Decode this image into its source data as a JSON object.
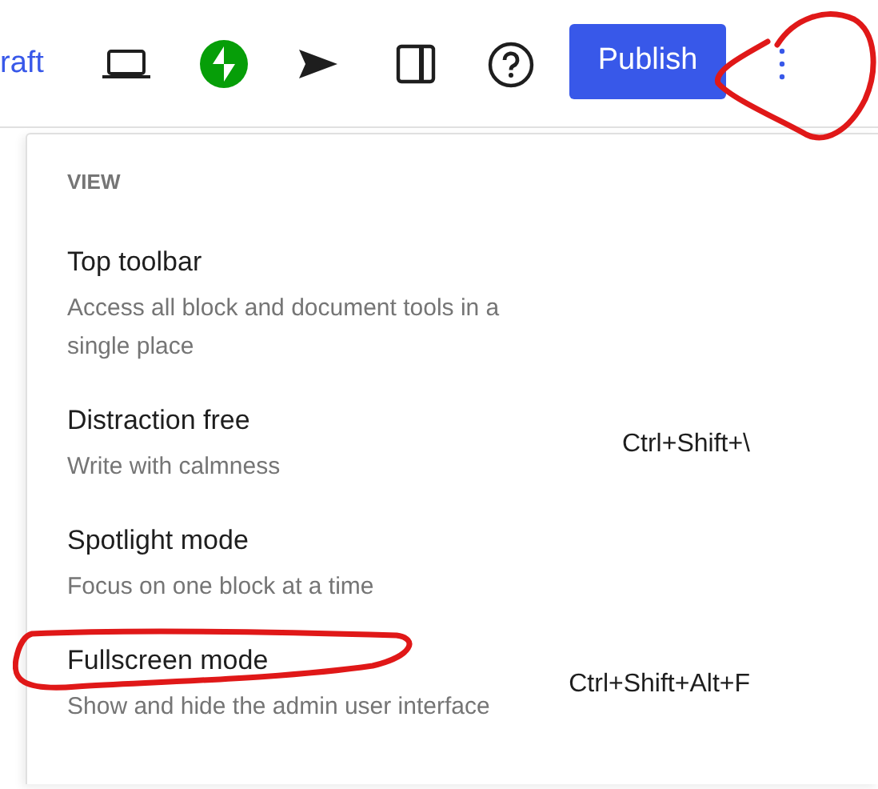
{
  "toolbar": {
    "draft_link": "raft",
    "publish_button": "Publish"
  },
  "menu": {
    "section_label": "VIEW",
    "items": [
      {
        "title": "Top toolbar",
        "description": "Access all block and document tools in a single place"
      },
      {
        "title": "Distraction free",
        "description": "Write with calmness",
        "shortcut": "Ctrl+Shift+\\"
      },
      {
        "title": "Spotlight mode",
        "description": "Focus on one block at a time"
      },
      {
        "title": "Fullscreen mode",
        "description": "Show and hide the admin user interface",
        "shortcut": "Ctrl+Shift+Alt+F"
      }
    ]
  }
}
